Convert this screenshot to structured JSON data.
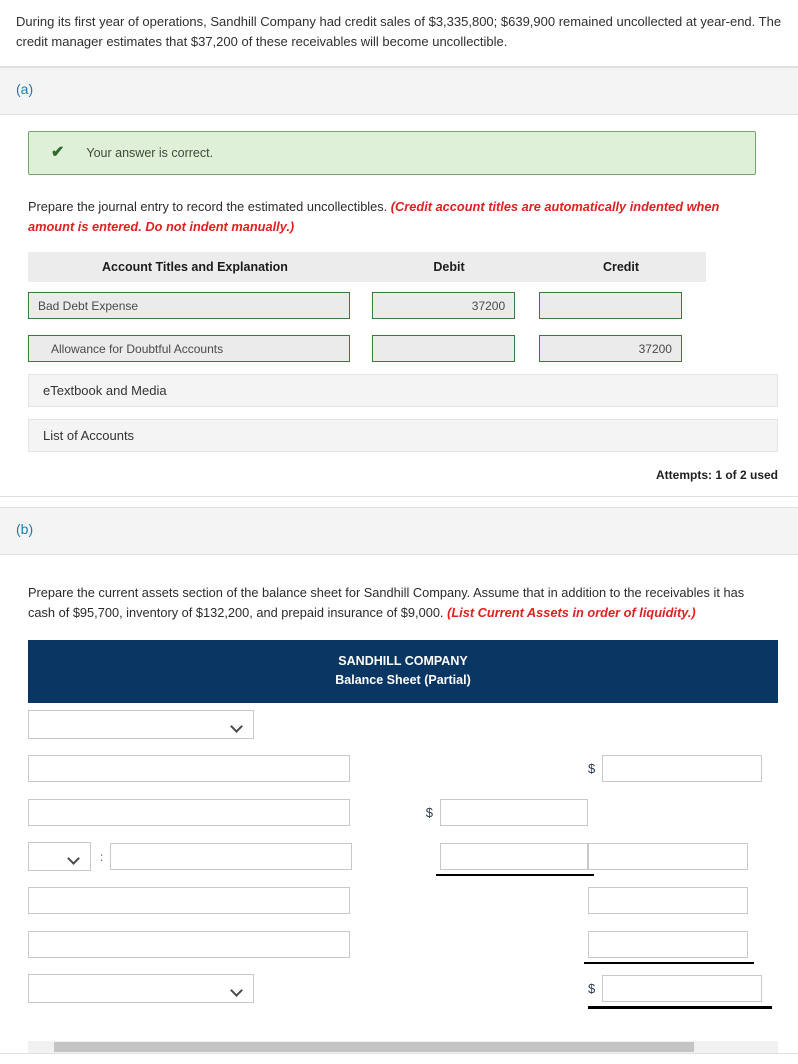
{
  "intro": {
    "text": "During its first year of operations, Sandhill Company had credit sales of $3,335,800; $639,900 remained uncollected at year-end. The credit manager estimates that $37,200 of these receivables will become uncollectible."
  },
  "part_a": {
    "label": "(a)",
    "banner": {
      "icon": "check-icon",
      "text": "Your answer is correct."
    },
    "instruction_plain": "Prepare the journal entry to record the estimated uncollectibles. ",
    "instruction_emphasis": "(Credit account titles are automatically indented when amount is entered. Do not indent manually.)",
    "table": {
      "headers": [
        "Account Titles and Explanation",
        "Debit",
        "Credit"
      ],
      "rows": [
        {
          "account": "Bad Debt Expense",
          "indented": false,
          "debit": "37200",
          "credit": ""
        },
        {
          "account": "Allowance for Doubtful Accounts",
          "indented": true,
          "debit": "",
          "credit": "37200"
        }
      ]
    },
    "etextbook_label": "eTextbook and Media",
    "list_of_accounts_label": "List of Accounts",
    "attempts": "Attempts: 1 of 2 used"
  },
  "part_b": {
    "label": "(b)",
    "instruction_plain": "Prepare the current assets section of the balance sheet for Sandhill Company. Assume that in addition to the receivables it has cash of $95,700, inventory of $132,200, and prepaid insurance of $9,000. ",
    "instruction_emphasis": "(List Current Assets in order of liquidity.)",
    "statement_header": {
      "company": "SANDHILL COMPANY",
      "subtitle": "Balance Sheet (Partial)",
      "background": "#0a3663"
    },
    "rows": [
      {
        "kind": "select",
        "select_value": "",
        "label_value": "",
        "mid_value": "",
        "mid_dollar": false,
        "right_value": "",
        "right_dollar": false
      },
      {
        "kind": "text",
        "label_value": "",
        "mid_value": "",
        "mid_dollar": false,
        "right_value": "",
        "right_dollar": true
      },
      {
        "kind": "text",
        "label_value": "",
        "mid_value": "",
        "mid_dollar": true,
        "right_value": "",
        "right_dollar": false
      },
      {
        "kind": "select-text",
        "select_value": "",
        "separator": ":",
        "label_value": "",
        "mid_value": "",
        "mid_dollar": false,
        "right_value": "",
        "right_dollar": false
      },
      {
        "kind": "text",
        "label_value": "",
        "mid_value": "",
        "mid_dollar": false,
        "right_value": "",
        "right_dollar": false
      },
      {
        "kind": "text",
        "label_value": "",
        "mid_value": "",
        "mid_dollar": false,
        "right_value": "",
        "right_dollar": false
      },
      {
        "kind": "select",
        "select_value": "",
        "label_value": "",
        "mid_value": "",
        "mid_dollar": false,
        "right_value": "",
        "right_dollar": true
      }
    ]
  },
  "colors": {
    "accent_blue": "#1f7ba8",
    "statement_navy": "#0a3663",
    "success_bg": "#dff0d8",
    "success_border": "#73a76d",
    "emphasis_red": "#e02020",
    "correct_field_border": "#3c7a3c"
  }
}
